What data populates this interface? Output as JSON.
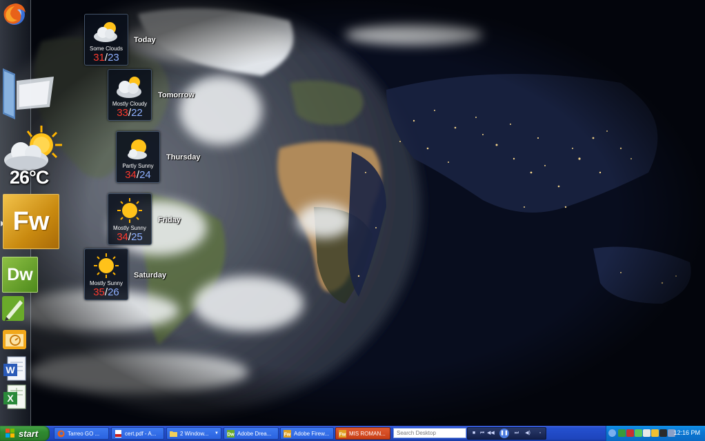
{
  "current_weather": {
    "temperature": "26°C"
  },
  "dock": {
    "items": [
      {
        "name": "Firefox"
      },
      {
        "name": "Windows"
      },
      {
        "name": "Fireworks",
        "label": "Fw"
      },
      {
        "name": "Dreamweaver",
        "label": "Dw"
      },
      {
        "name": "Corel"
      },
      {
        "name": "Outlook"
      },
      {
        "name": "Word"
      },
      {
        "name": "Excel"
      }
    ]
  },
  "forecast": [
    {
      "day": "Today",
      "condition": "Some Clouds",
      "high": "31",
      "low": "23",
      "icon": "cloud-sun-icon"
    },
    {
      "day": "Tomorrow",
      "condition": "Mostly Cloudy",
      "high": "33",
      "low": "22",
      "icon": "cloud-sun-icon"
    },
    {
      "day": "Thursday",
      "condition": "Partly Sunny",
      "high": "34",
      "low": "24",
      "icon": "sun-cloud-icon"
    },
    {
      "day": "Friday",
      "condition": "Mostly Sunny",
      "high": "34",
      "low": "25",
      "icon": "sun-icon"
    },
    {
      "day": "Saturday",
      "condition": "Mostly Sunny",
      "high": "35",
      "low": "26",
      "icon": "sun-icon"
    }
  ],
  "forecast_separator": "/",
  "taskbar": {
    "start_label": "start",
    "tasks": [
      {
        "label": "Tarreo GO ...",
        "icon": "firefox-icon"
      },
      {
        "label": "cert.pdf - A...",
        "icon": "pdf-icon"
      },
      {
        "label": "2 Window...",
        "icon": "folder-icon"
      },
      {
        "label": "Adobe Drea...",
        "icon": "dreamweaver-icon"
      },
      {
        "label": "Adobe Firew...",
        "icon": "fireworks-icon"
      },
      {
        "label": "MIS ROMAN...",
        "icon": "fireworks-icon",
        "active": true
      }
    ],
    "search_placeholder": "Search Desktop",
    "clock": "12:16 PM"
  },
  "colors": {
    "taskbar": "#2450cf",
    "start": "#2f8a2f",
    "tray": "#0b78d4",
    "temp_high": "#ff3a2e",
    "temp_low": "#8fb0ff"
  }
}
